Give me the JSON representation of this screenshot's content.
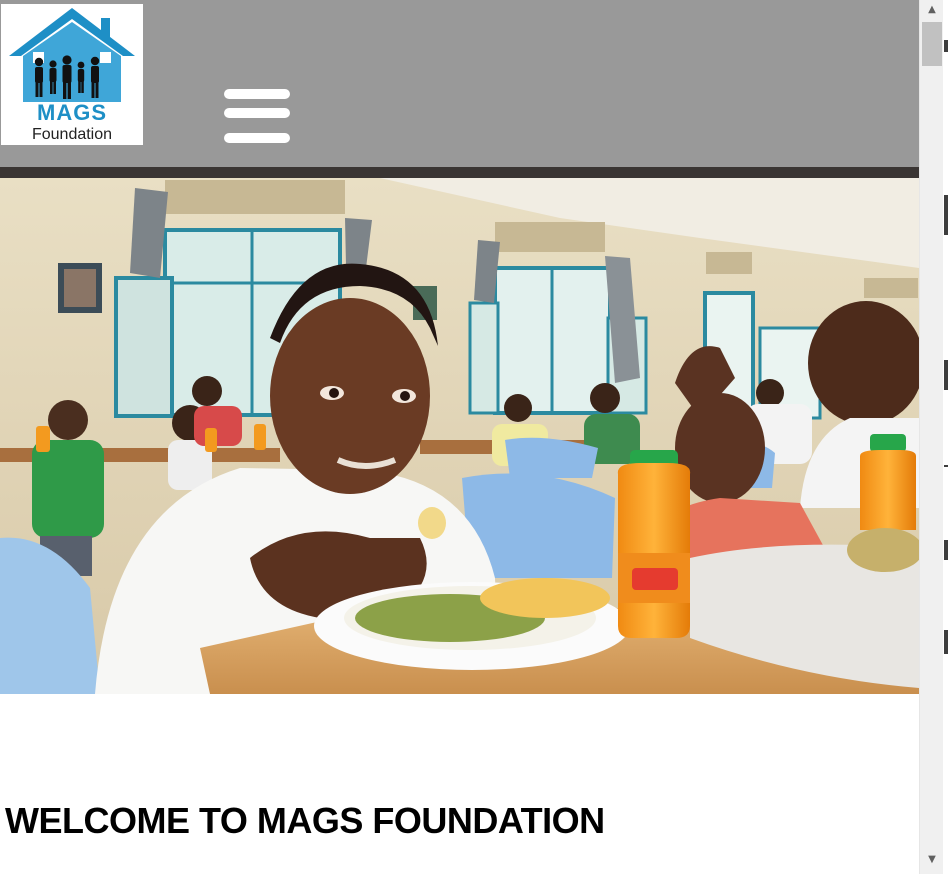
{
  "header": {
    "logo": {
      "name": "MAGS",
      "subtitle": "Foundation"
    },
    "menu_toggle_icon": "hamburger-menu-icon",
    "background_color": "#999999",
    "rule_color": "#3a3533"
  },
  "hero": {
    "image_alt": "Children eating a meal together in a dining hall"
  },
  "welcome": {
    "title": "WELCOME TO MAGS FOUNDATION"
  },
  "scrollbar": {
    "up_icon": "scroll-up-arrow-icon",
    "down_icon": "scroll-down-arrow-icon"
  },
  "colors": {
    "brand_blue": "#1e8fc6",
    "text": "#000000"
  }
}
